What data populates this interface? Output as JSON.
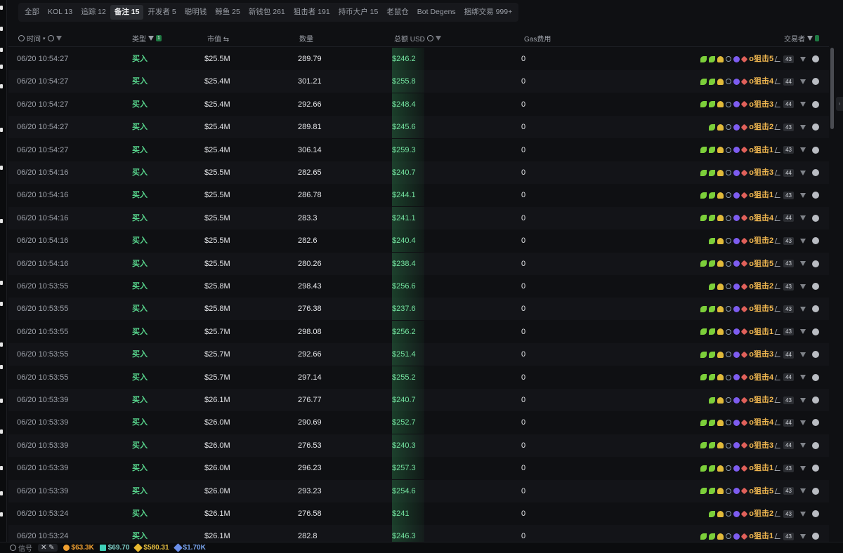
{
  "tabs": [
    {
      "label": "全部",
      "active": false
    },
    {
      "label": "KOL 13",
      "active": false
    },
    {
      "label": "追踪 12",
      "active": false
    },
    {
      "label": "备注 15",
      "active": true
    },
    {
      "label": "开发者 5",
      "active": false
    },
    {
      "label": "聪明钱",
      "active": false
    },
    {
      "label": "鲸鱼 25",
      "active": false
    },
    {
      "label": "新钱包 261",
      "active": false
    },
    {
      "label": "狙击者 191",
      "active": false
    },
    {
      "label": "持币大户 15",
      "active": false
    },
    {
      "label": "老鼠仓",
      "active": false
    },
    {
      "label": "Bot Degens",
      "active": false
    },
    {
      "label": "捆绑交易 999+",
      "active": false
    }
  ],
  "headers": {
    "time": "时间",
    "type": "类型",
    "type_badge": "1",
    "mcap": "市值 ⇆",
    "qty": "数量",
    "usd": "总额 USD",
    "gas": "Gas费用",
    "trader": "交易者"
  },
  "rows": [
    {
      "time": "06/20 10:54:27",
      "type": "买入",
      "mc": "$25.5M",
      "qty": "289.79",
      "usd": "$246.2",
      "gas": "0",
      "trader": "o狙击5",
      "n": "43",
      "leaf2": true
    },
    {
      "time": "06/20 10:54:27",
      "type": "买入",
      "mc": "$25.4M",
      "qty": "301.21",
      "usd": "$255.8",
      "gas": "0",
      "trader": "o狙击4",
      "n": "44",
      "leaf2": true
    },
    {
      "time": "06/20 10:54:27",
      "type": "买入",
      "mc": "$25.4M",
      "qty": "292.66",
      "usd": "$248.4",
      "gas": "0",
      "trader": "o狙击3",
      "n": "44",
      "leaf2": true
    },
    {
      "time": "06/20 10:54:27",
      "type": "买入",
      "mc": "$25.4M",
      "qty": "289.81",
      "usd": "$245.6",
      "gas": "0",
      "trader": "o狙击2",
      "n": "43",
      "leaf2": false
    },
    {
      "time": "06/20 10:54:27",
      "type": "买入",
      "mc": "$25.4M",
      "qty": "306.14",
      "usd": "$259.3",
      "gas": "0",
      "trader": "o狙击1",
      "n": "43",
      "leaf2": true
    },
    {
      "time": "06/20 10:54:16",
      "type": "买入",
      "mc": "$25.5M",
      "qty": "282.65",
      "usd": "$240.7",
      "gas": "0",
      "trader": "o狙击3",
      "n": "44",
      "leaf2": true
    },
    {
      "time": "06/20 10:54:16",
      "type": "买入",
      "mc": "$25.5M",
      "qty": "286.78",
      "usd": "$244.1",
      "gas": "0",
      "trader": "o狙击1",
      "n": "43",
      "leaf2": true
    },
    {
      "time": "06/20 10:54:16",
      "type": "买入",
      "mc": "$25.5M",
      "qty": "283.3",
      "usd": "$241.1",
      "gas": "0",
      "trader": "o狙击4",
      "n": "44",
      "leaf2": true
    },
    {
      "time": "06/20 10:54:16",
      "type": "买入",
      "mc": "$25.5M",
      "qty": "282.6",
      "usd": "$240.4",
      "gas": "0",
      "trader": "o狙击2",
      "n": "43",
      "leaf2": false
    },
    {
      "time": "06/20 10:54:16",
      "type": "买入",
      "mc": "$25.5M",
      "qty": "280.26",
      "usd": "$238.4",
      "gas": "0",
      "trader": "o狙击5",
      "n": "43",
      "leaf2": true
    },
    {
      "time": "06/20 10:53:55",
      "type": "买入",
      "mc": "$25.8M",
      "qty": "298.43",
      "usd": "$256.6",
      "gas": "0",
      "trader": "o狙击2",
      "n": "43",
      "leaf2": false
    },
    {
      "time": "06/20 10:53:55",
      "type": "买入",
      "mc": "$25.8M",
      "qty": "276.38",
      "usd": "$237.6",
      "gas": "0",
      "trader": "o狙击5",
      "n": "43",
      "leaf2": true
    },
    {
      "time": "06/20 10:53:55",
      "type": "买入",
      "mc": "$25.7M",
      "qty": "298.08",
      "usd": "$256.2",
      "gas": "0",
      "trader": "o狙击1",
      "n": "43",
      "leaf2": true
    },
    {
      "time": "06/20 10:53:55",
      "type": "买入",
      "mc": "$25.7M",
      "qty": "292.66",
      "usd": "$251.4",
      "gas": "0",
      "trader": "o狙击3",
      "n": "44",
      "leaf2": true
    },
    {
      "time": "06/20 10:53:55",
      "type": "买入",
      "mc": "$25.7M",
      "qty": "297.14",
      "usd": "$255.2",
      "gas": "0",
      "trader": "o狙击4",
      "n": "44",
      "leaf2": true
    },
    {
      "time": "06/20 10:53:39",
      "type": "买入",
      "mc": "$26.1M",
      "qty": "276.77",
      "usd": "$240.7",
      "gas": "0",
      "trader": "o狙击2",
      "n": "43",
      "leaf2": false
    },
    {
      "time": "06/20 10:53:39",
      "type": "买入",
      "mc": "$26.0M",
      "qty": "290.69",
      "usd": "$252.7",
      "gas": "0",
      "trader": "o狙击4",
      "n": "44",
      "leaf2": true
    },
    {
      "time": "06/20 10:53:39",
      "type": "买入",
      "mc": "$26.0M",
      "qty": "276.53",
      "usd": "$240.3",
      "gas": "0",
      "trader": "o狙击3",
      "n": "44",
      "leaf2": true
    },
    {
      "time": "06/20 10:53:39",
      "type": "买入",
      "mc": "$26.0M",
      "qty": "296.23",
      "usd": "$257.3",
      "gas": "0",
      "trader": "o狙击1",
      "n": "43",
      "leaf2": true
    },
    {
      "time": "06/20 10:53:39",
      "type": "买入",
      "mc": "$26.0M",
      "qty": "293.23",
      "usd": "$254.6",
      "gas": "0",
      "trader": "o狙击5",
      "n": "43",
      "leaf2": true
    },
    {
      "time": "06/20 10:53:24",
      "type": "买入",
      "mc": "$26.1M",
      "qty": "276.58",
      "usd": "$241",
      "gas": "0",
      "trader": "o狙击2",
      "n": "43",
      "leaf2": false
    },
    {
      "time": "06/20 10:53:24",
      "type": "买入",
      "mc": "$26.1M",
      "qty": "282.8",
      "usd": "$246.3",
      "gas": "0",
      "trader": "o狙击1",
      "n": "43",
      "leaf2": true
    }
  ],
  "footer": {
    "signal": "信号",
    "btc": "$63.3K",
    "sol": "$69.70",
    "bnb": "$580.31",
    "eth": "$1.70K"
  },
  "colors": {
    "buy": "#58d68d",
    "trader": "#f0b750",
    "bg": "#0f1013"
  }
}
